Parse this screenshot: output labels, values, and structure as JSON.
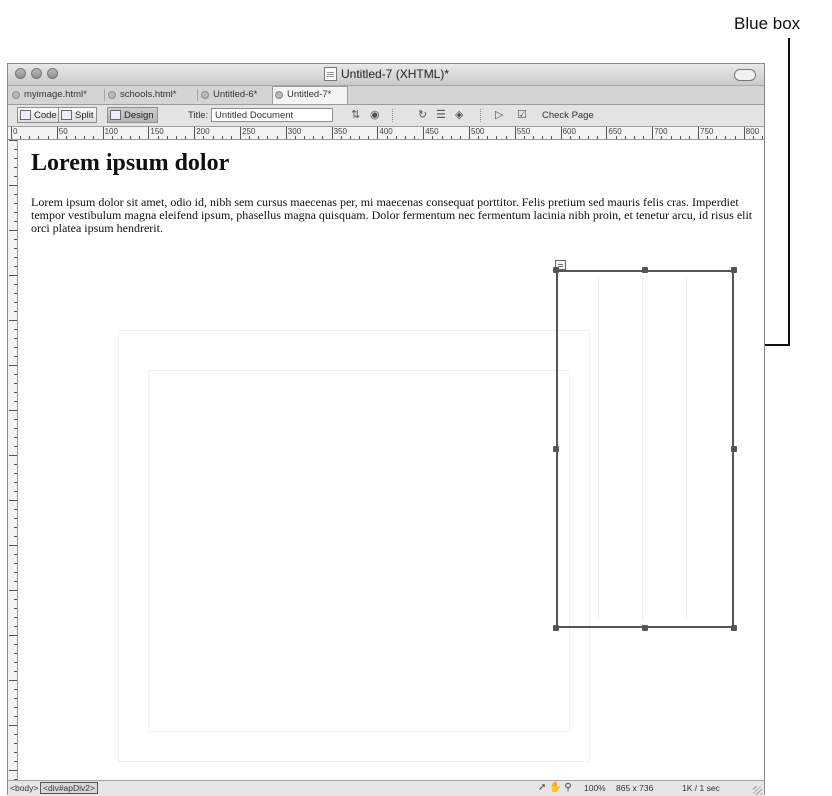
{
  "annotation": {
    "label": "Blue box"
  },
  "window": {
    "title": "Untitled-7 (XHTML)*",
    "tabs": [
      {
        "label": "myimage.html*"
      },
      {
        "label": "schools.html*"
      },
      {
        "label": "Untitled-6*"
      },
      {
        "label": "Untitled-7*"
      }
    ]
  },
  "toolbar": {
    "code_label": "Code",
    "split_label": "Split",
    "design_label": "Design",
    "title_label": "Title:",
    "title_value": "Untitled Document",
    "check_page_label": "Check Page"
  },
  "ruler": {
    "h_labels": [
      "0",
      "50",
      "100",
      "150",
      "200",
      "250",
      "300",
      "350",
      "400",
      "450",
      "500",
      "550",
      "600",
      "650",
      "700",
      "750",
      "800",
      "85"
    ]
  },
  "document": {
    "heading": "Lorem ipsum dolor",
    "paragraph": "Lorem ipsum dolor sit amet, odio id, nibh sem cursus maecenas per, mi maecenas consequat porttitor. Felis pretium sed mauris felis cras. Imperdiet tempor vestibulum magna eleifend ipsum, phasellus magna quisquam. Dolor fermentum nec fermentum lacinia nibh proin, et tenetur arcu, id risus elit orci platea ipsum hendrerit."
  },
  "status": {
    "tag_body": "<body>",
    "tag_div": "<div#apDiv2>",
    "zoom": "100%",
    "size": "865 x 736",
    "download": "1K / 1 sec"
  }
}
